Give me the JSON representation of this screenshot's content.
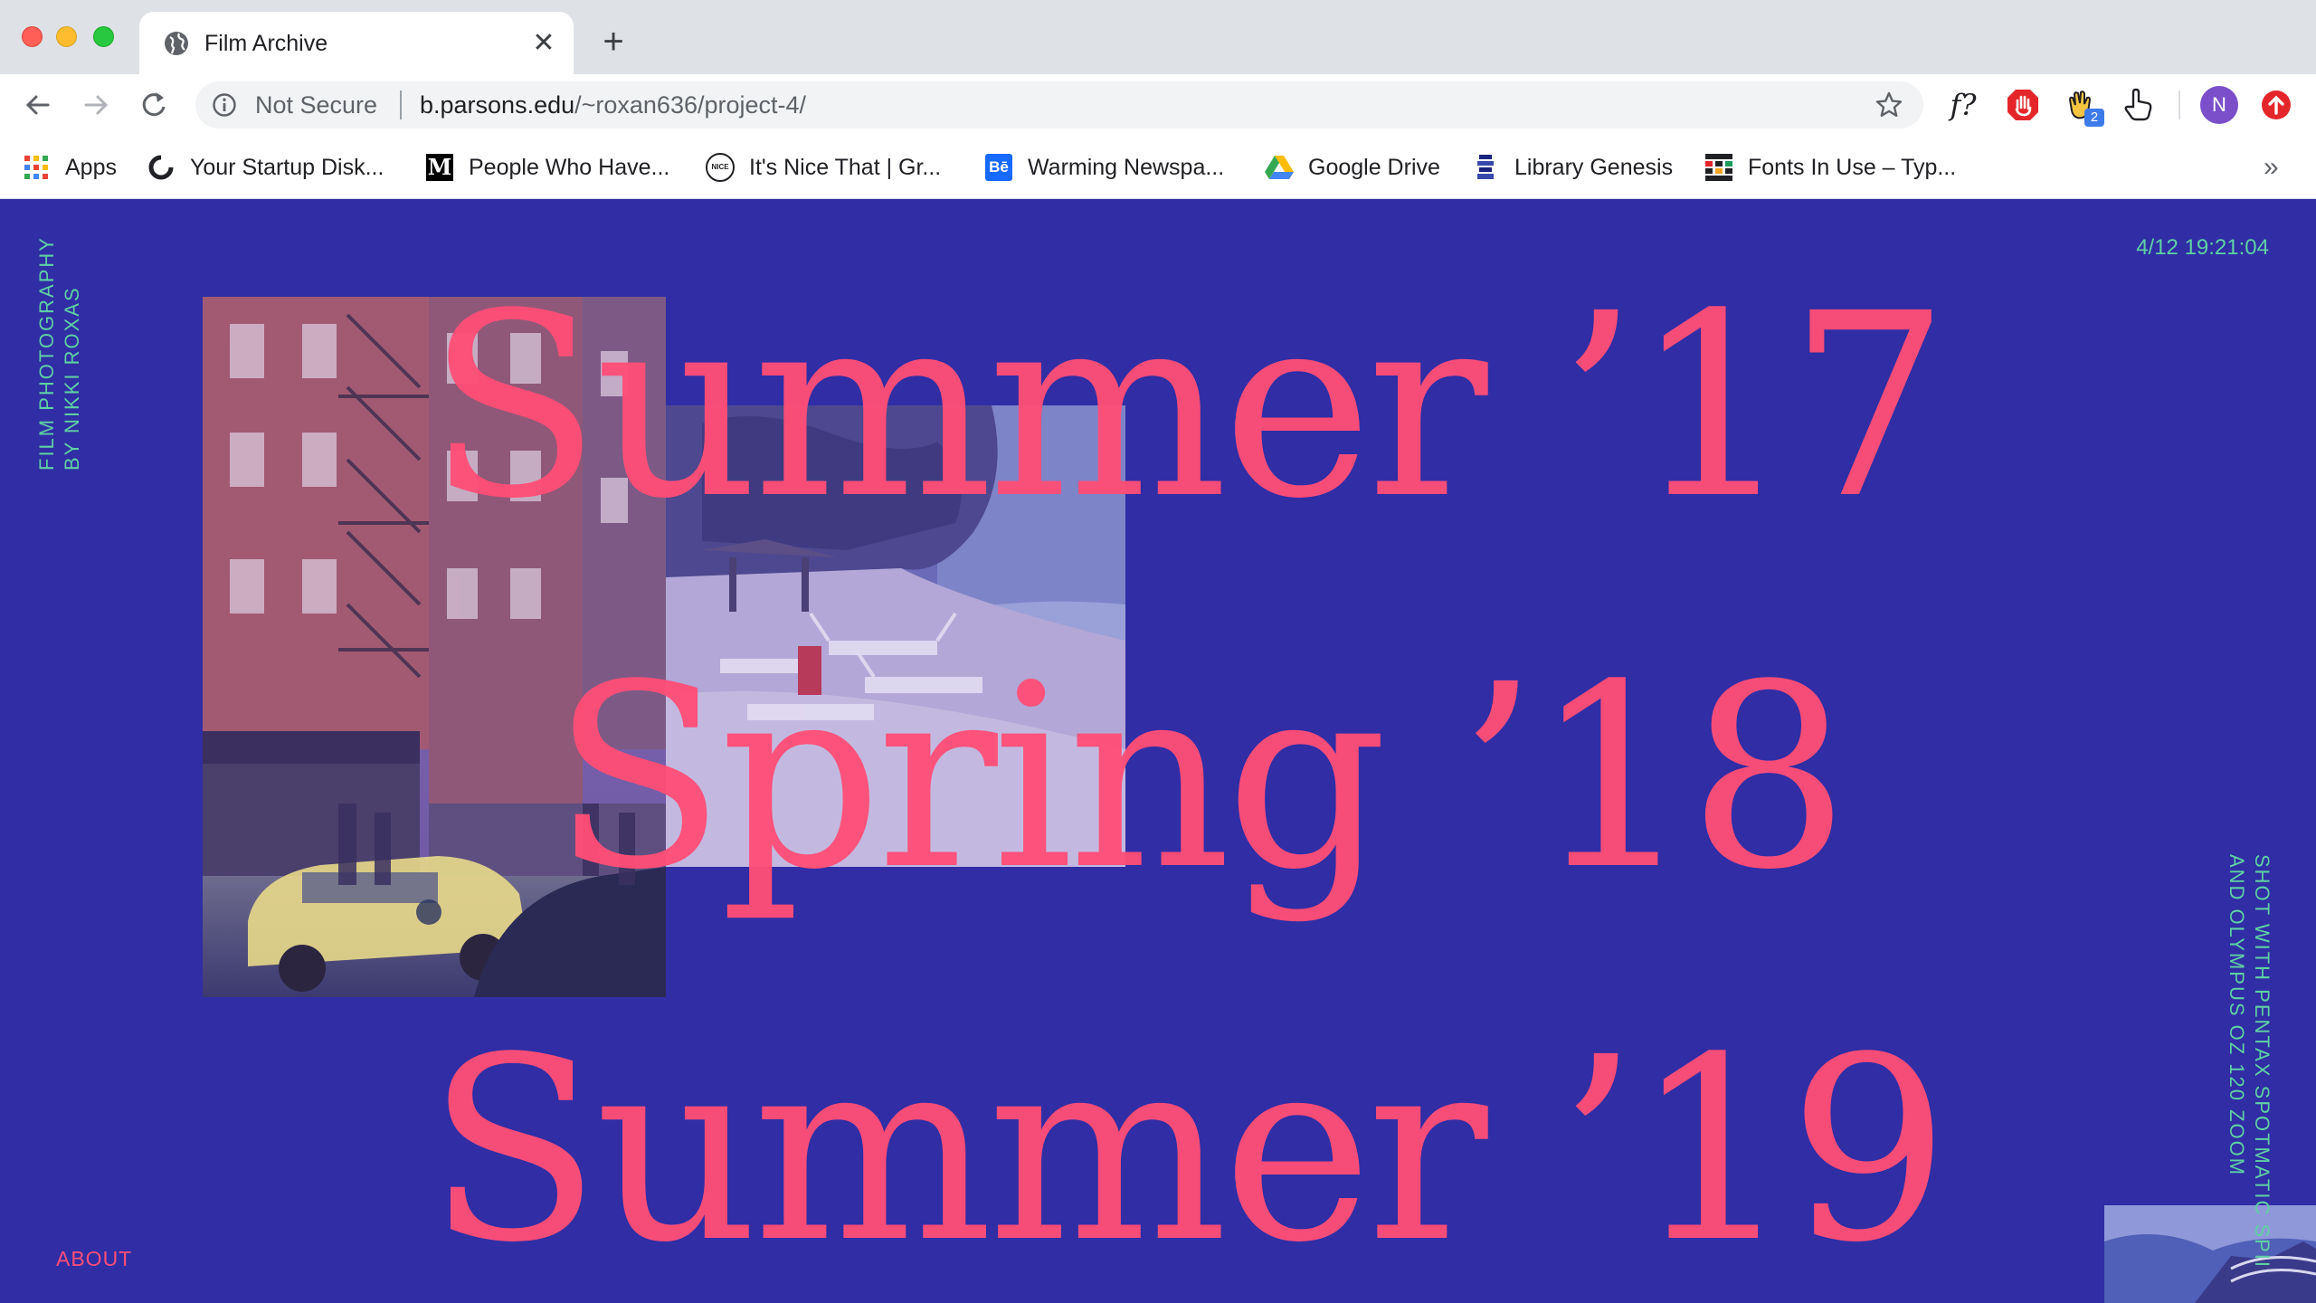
{
  "browser": {
    "tab": {
      "title": "Film Archive",
      "close_glyph": "✕"
    },
    "new_tab_glyph": "+",
    "address": {
      "security_label": "Not Secure",
      "url_host": "b.parsons.edu",
      "url_path": "/~roxan636/project-4/"
    },
    "profile_initial": "N",
    "extensions": [
      {
        "name": "whatfont-icon",
        "glyph": "f?"
      },
      {
        "name": "adblock-icon"
      },
      {
        "name": "honey-hand-icon",
        "badge": "2"
      },
      {
        "name": "pointer-hand-icon"
      },
      {
        "name": "update-icon"
      }
    ],
    "bookmarks": [
      {
        "label": "Apps",
        "icon": "apps-grid-icon"
      },
      {
        "label": "Your Startup Disk...",
        "icon": "loader-icon"
      },
      {
        "label": "People Who Have...",
        "icon": "medium-icon",
        "glyph": "M"
      },
      {
        "label": "It's Nice That | Gr...",
        "icon": "nice-that-icon",
        "glyph": "NICE"
      },
      {
        "label": "Warming Newspa...",
        "icon": "behance-icon",
        "glyph": "Bē"
      },
      {
        "label": "Google Drive",
        "icon": "google-drive-icon"
      },
      {
        "label": "Library Genesis",
        "icon": "library-genesis-icon"
      },
      {
        "label": "Fonts In Use – Typ...",
        "icon": "fonts-in-use-icon"
      }
    ],
    "bookmarks_overflow": "»"
  },
  "page": {
    "side_left_line1": "FILM PHOTOGRAPHY",
    "side_left_line2": "BY NIKKI ROXAS",
    "timestamp": "4/12 19:21:04",
    "seasons": [
      "Summer ’17",
      "Spring ’18",
      "Summer ’19"
    ],
    "about_label": "ABOUT",
    "side_right_line1": "SHOT WITH PENTAX SPOTMATIC SPII",
    "side_right_line2": "AND OLYMPUS OZ 120 ZOOM",
    "colors": {
      "background": "#302da5",
      "accent_pink": "#ff4e77",
      "accent_green": "#5fd1a4"
    }
  }
}
